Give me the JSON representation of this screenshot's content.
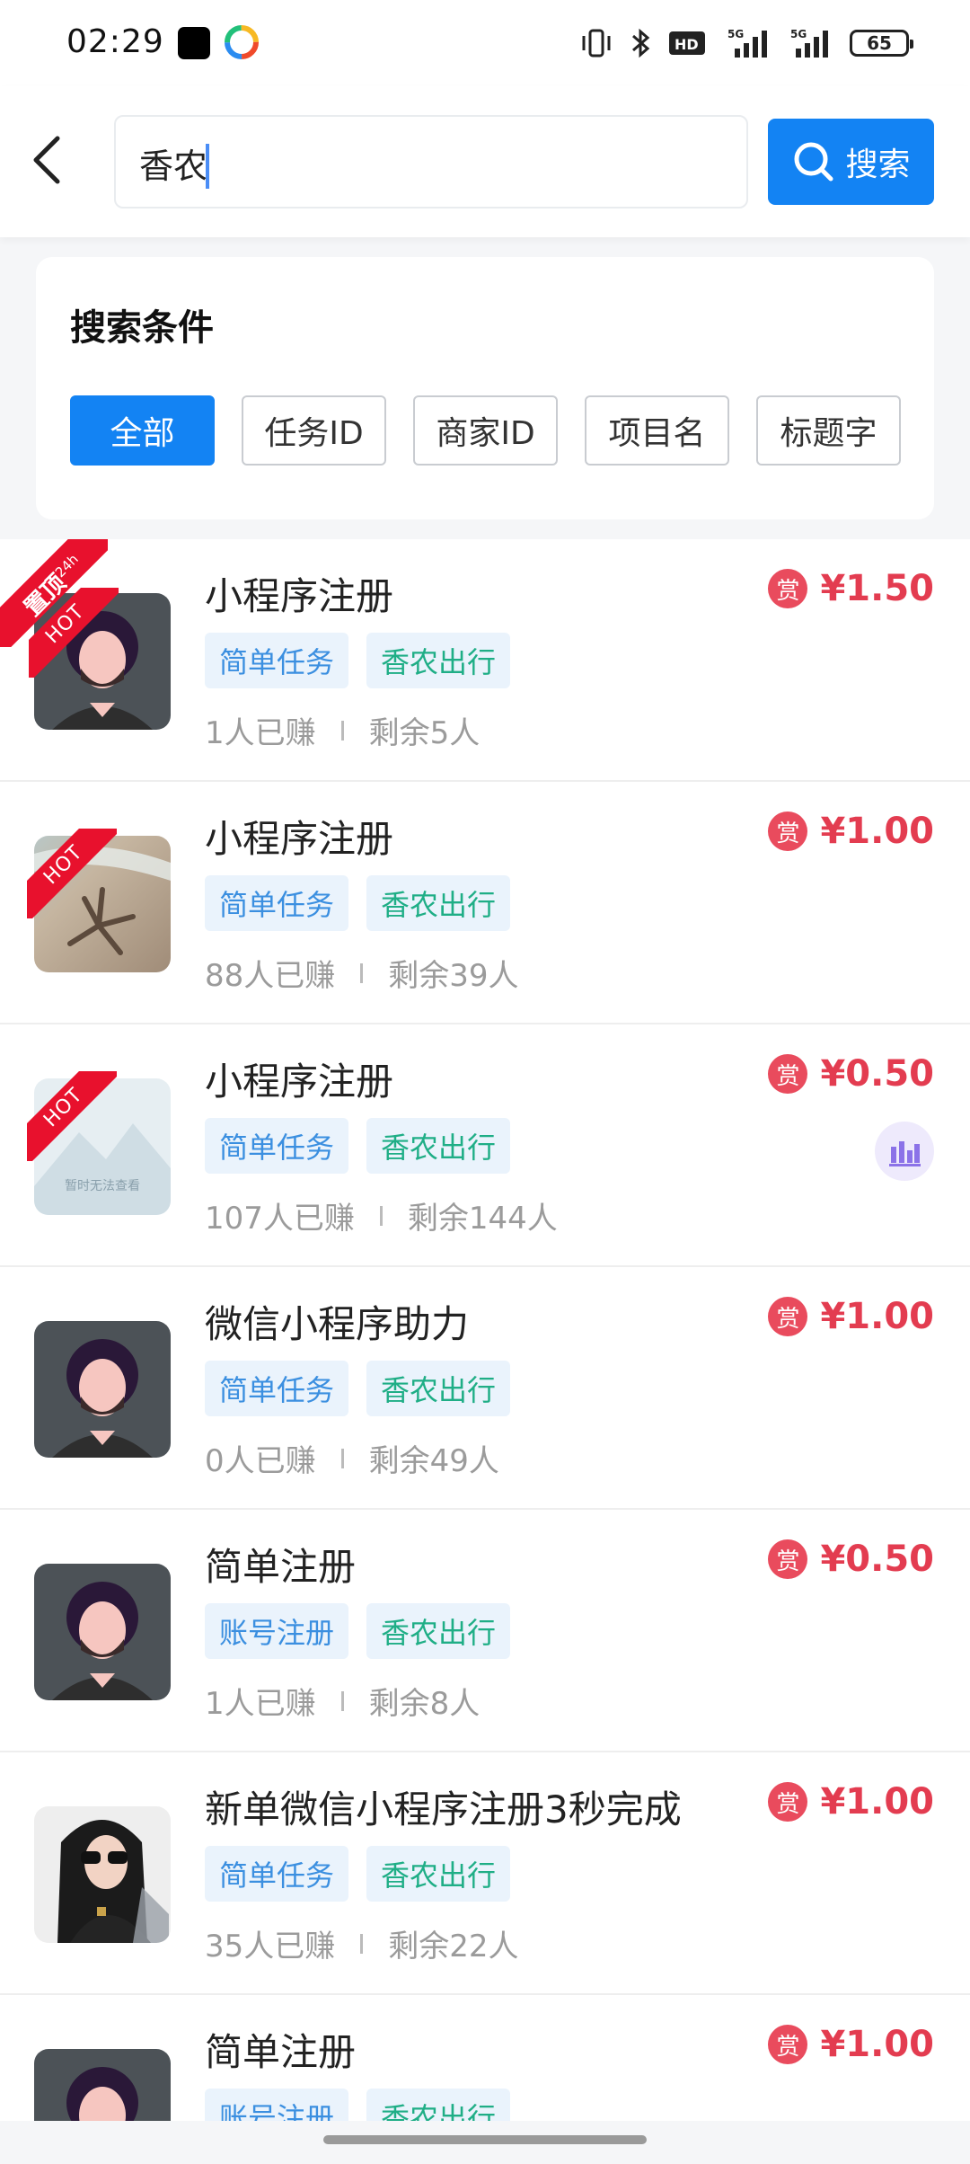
{
  "status_bar": {
    "time": "02:29",
    "battery": "65",
    "icons": [
      "vibrate-icon",
      "bluetooth-icon",
      "hd-icon",
      "5g-signal-icon",
      "5g-signal-icon",
      "battery-icon"
    ]
  },
  "header": {
    "search_value": "香农",
    "search_button_label": "搜索"
  },
  "conditions": {
    "title": "搜索条件",
    "tags": [
      "全部",
      "任务ID",
      "商家ID",
      "项目名",
      "标题字"
    ],
    "active_index": 0
  },
  "tasks": [
    {
      "title": "小程序注册",
      "type_tag": "简单任务",
      "project_tag": "香农出行",
      "earned": "1人已赚",
      "remaining": "剩余5人",
      "reward_badge": "赏",
      "reward": "¥1.50",
      "ribbon": "置顶",
      "ribbon_sub": "24h",
      "hot": "HOT",
      "avatar": "man-avatar"
    },
    {
      "title": "小程序注册",
      "type_tag": "简单任务",
      "project_tag": "香农出行",
      "earned": "88人已赚",
      "remaining": "剩余39人",
      "reward_badge": "赏",
      "reward": "¥1.00",
      "hot": "HOT",
      "avatar": "beach-starfish"
    },
    {
      "title": "小程序注册",
      "type_tag": "简单任务",
      "project_tag": "香农出行",
      "earned": "107人已赚",
      "remaining": "剩余144人",
      "reward_badge": "赏",
      "reward": "¥0.50",
      "hot": "HOT",
      "avatar": "placeholder",
      "placeholder_text": "暂时无法查看"
    },
    {
      "title": "微信小程序助力",
      "type_tag": "简单任务",
      "project_tag": "香农出行",
      "earned": "0人已赚",
      "remaining": "剩余49人",
      "reward_badge": "赏",
      "reward": "¥1.00",
      "avatar": "man-avatar"
    },
    {
      "title": "简单注册",
      "type_tag": "账号注册",
      "project_tag": "香农出行",
      "earned": "1人已赚",
      "remaining": "剩余8人",
      "reward_badge": "赏",
      "reward": "¥0.50",
      "avatar": "man-avatar"
    },
    {
      "title": "新单微信小程序注册3秒完成",
      "type_tag": "简单任务",
      "project_tag": "香农出行",
      "earned": "35人已赚",
      "remaining": "剩余22人",
      "reward_badge": "赏",
      "reward": "¥1.00",
      "avatar": "woman-photo"
    },
    {
      "title": "简单注册",
      "type_tag": "账号注册",
      "project_tag": "香农出行",
      "earned": "",
      "remaining": "",
      "reward_badge": "赏",
      "reward": "¥1.00",
      "avatar": "man-avatar"
    }
  ],
  "colors": {
    "accent": "#1383f3",
    "reward": "#e33c50",
    "hot": "#e8112d",
    "project_tag_text": "#1fae86"
  }
}
